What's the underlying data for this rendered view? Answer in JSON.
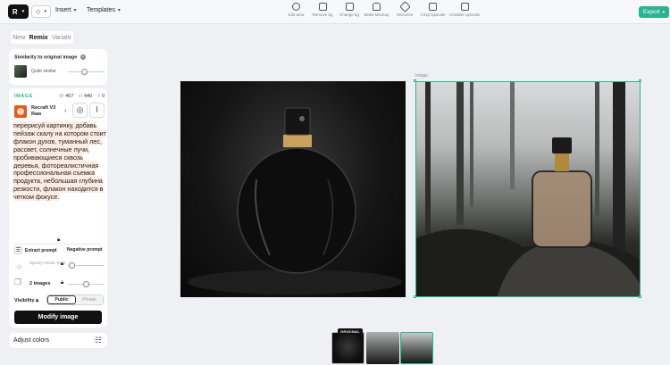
{
  "topbar": {
    "logo_icon": "logo-icon",
    "insert_label": "Insert",
    "templates_label": "Templates",
    "tools": [
      {
        "label": "Edit area",
        "icon": "lasso-icon"
      },
      {
        "label": "Remove bg",
        "icon": "remove-bg-icon"
      },
      {
        "label": "Change bg",
        "icon": "change-bg-icon"
      },
      {
        "label": "Make Mockup",
        "icon": "mockup-icon"
      },
      {
        "label": "Vectorize",
        "icon": "vectorize-icon"
      },
      {
        "label": "Crisp Upscale",
        "icon": "crisp-upscale-icon"
      },
      {
        "label": "Creative Upscale",
        "icon": "creative-upscale-icon"
      }
    ],
    "export_label": "Export",
    "accent_color": "#2bb38f"
  },
  "panel": {
    "tabs": [
      {
        "label": "New",
        "active": false
      },
      {
        "label": "Remix",
        "active": true
      },
      {
        "label": "Variate",
        "active": false
      }
    ],
    "similarity": {
      "title": "Similarity to original image",
      "help": "?",
      "value_label": "Quite similar",
      "level": 0.45
    },
    "image": {
      "section_label": "IMAGE",
      "width_key": "W",
      "width": "457",
      "height_key": "H",
      "height": "440",
      "count_key": "#",
      "count": "0",
      "model_name": "Recraft V3 Raw",
      "prompt": "перерисуй картинку, добавь пейзаж скалу на котором стоит флакон духов, туманный лес, рассвет, солнечные лучи, пробивающиеся сквозь деревья, фотореалистичная профессиональная съемка продукта, небольшая глубина резкости, флакон находится в четком фокусе.",
      "extract_prompt_label": "Extract prompt",
      "negative_prompt_label": "Negative prompt",
      "artistic_label": "Specify Artistic level",
      "artistic_level": 0.1,
      "images_label": "2 images",
      "images_level": 0.5,
      "visibility_label": "Visibility",
      "visibility_options": [
        "Public",
        "Private"
      ],
      "visibility_selected": "Public",
      "modify_label": "Modify image"
    },
    "adjust_label": "Adjust colors"
  },
  "canvas": {
    "selected_tag": "Image"
  },
  "history": {
    "original_badge": "ORIGINAL",
    "count": 3,
    "selected_index": 2
  }
}
